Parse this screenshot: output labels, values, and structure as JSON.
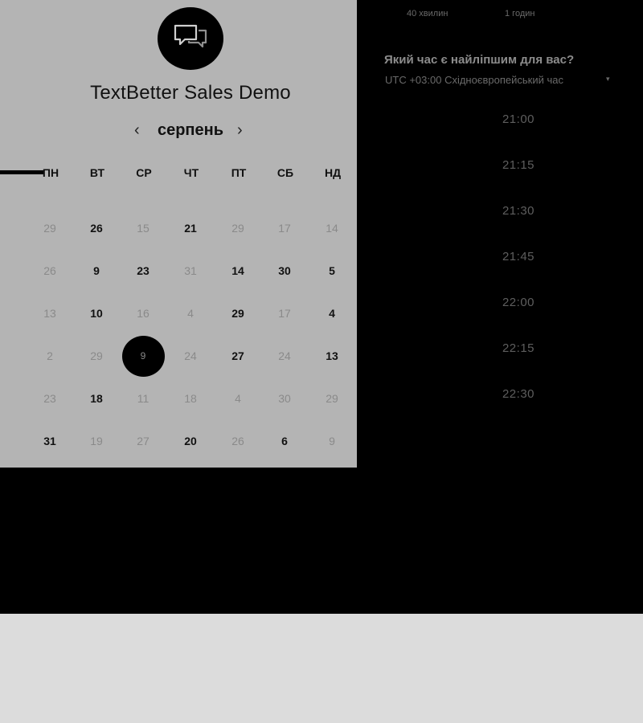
{
  "header": {
    "title": "TextBetter Sales Demo",
    "logo_icon": "chat-bubbles-icon"
  },
  "calendar": {
    "month": "серпень",
    "prev_arrow": "‹",
    "next_arrow": "›",
    "weekdays": [
      "ПН",
      "ВТ",
      "СР",
      "ЧТ",
      "ПТ",
      "СБ",
      "НД"
    ],
    "rows": [
      [
        "29",
        "26",
        "15",
        "21",
        "29",
        "17",
        "14"
      ],
      [
        "26",
        "9",
        "23",
        "31",
        "14",
        "30",
        "5"
      ],
      [
        "13",
        "10",
        "16",
        "4",
        "29",
        "17",
        "4"
      ],
      [
        "2",
        "29",
        "9",
        "24",
        "27",
        "24",
        "13"
      ],
      [
        "23",
        "18",
        "11",
        "18",
        "4",
        "30",
        "29"
      ],
      [
        "31",
        "19",
        "27",
        "20",
        "26",
        "6",
        "9"
      ]
    ],
    "selected_day": "9"
  },
  "durations": [
    "40 хвилин",
    "1 годин"
  ],
  "schedule": {
    "question": "Який час є найліпшим для вас?",
    "timezone": "UTC +03:00 Східноєвропейський час",
    "timezone_arrow": "▾",
    "slots": [
      "21:00",
      "21:15",
      "21:30",
      "21:45",
      "22:00",
      "22:15",
      "22:30"
    ]
  },
  "colors": {
    "left_panel": "#b4b4b4",
    "right_panel": "#000000",
    "bottom_band": "#dcdcdc"
  }
}
